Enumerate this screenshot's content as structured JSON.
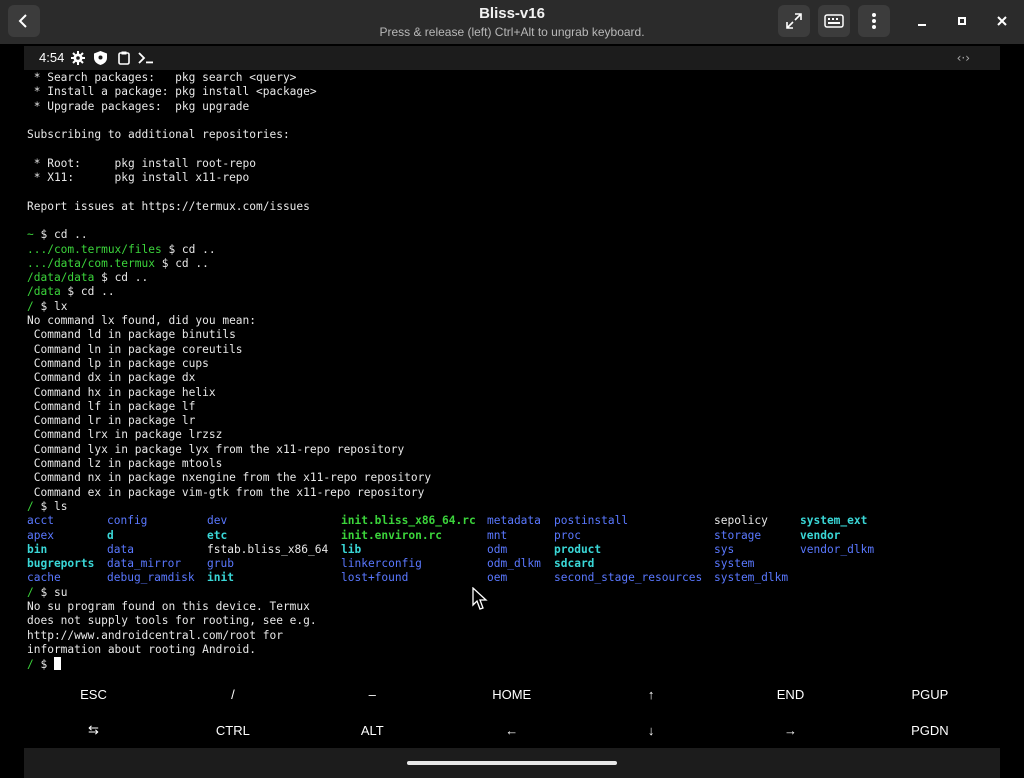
{
  "window": {
    "title": "Bliss-v16",
    "subtitle": "Press & release (left) Ctrl+Alt to ungrab keyboard."
  },
  "statusbar": {
    "time": "4:54"
  },
  "terminal": {
    "lines_top": [
      {
        "parts": [
          {
            "t": " * Search packages:   pkg search <query>"
          }
        ]
      },
      {
        "parts": [
          {
            "t": " * Install a package: pkg install <package>"
          }
        ]
      },
      {
        "parts": [
          {
            "t": " * Upgrade packages:  pkg upgrade"
          }
        ]
      },
      {
        "parts": [
          {
            "t": ""
          }
        ]
      },
      {
        "parts": [
          {
            "t": "Subscribing to additional repositories:"
          }
        ]
      },
      {
        "parts": [
          {
            "t": ""
          }
        ]
      },
      {
        "parts": [
          {
            "t": " * Root:     pkg install root-repo"
          }
        ]
      },
      {
        "parts": [
          {
            "t": " * X11:      pkg install x11-repo"
          }
        ]
      },
      {
        "parts": [
          {
            "t": ""
          }
        ]
      },
      {
        "parts": [
          {
            "t": "Report issues at https://termux.com/issues"
          }
        ]
      },
      {
        "parts": [
          {
            "t": ""
          }
        ]
      },
      {
        "parts": [
          {
            "t": "~",
            "c": "green"
          },
          {
            "t": " $ cd .."
          }
        ]
      },
      {
        "parts": [
          {
            "t": ".../com.termux/files",
            "c": "green"
          },
          {
            "t": " $ cd .."
          }
        ]
      },
      {
        "parts": [
          {
            "t": ".../data/com.termux",
            "c": "green"
          },
          {
            "t": " $ cd .."
          }
        ]
      },
      {
        "parts": [
          {
            "t": "/data/data",
            "c": "green"
          },
          {
            "t": " $ cd .."
          }
        ]
      },
      {
        "parts": [
          {
            "t": "/data",
            "c": "green"
          },
          {
            "t": " $ cd .."
          }
        ]
      },
      {
        "parts": [
          {
            "t": "/",
            "c": "green"
          },
          {
            "t": " $ lx"
          }
        ]
      },
      {
        "parts": [
          {
            "t": "No command lx found, did you mean:"
          }
        ]
      },
      {
        "parts": [
          {
            "t": " Command ld in package binutils"
          }
        ]
      },
      {
        "parts": [
          {
            "t": " Command ln in package coreutils"
          }
        ]
      },
      {
        "parts": [
          {
            "t": " Command lp in package cups"
          }
        ]
      },
      {
        "parts": [
          {
            "t": " Command dx in package dx"
          }
        ]
      },
      {
        "parts": [
          {
            "t": " Command hx in package helix"
          }
        ]
      },
      {
        "parts": [
          {
            "t": " Command lf in package lf"
          }
        ]
      },
      {
        "parts": [
          {
            "t": " Command lr in package lr"
          }
        ]
      },
      {
        "parts": [
          {
            "t": " Command lrx in package lrzsz"
          }
        ]
      },
      {
        "parts": [
          {
            "t": " Command lyx in package lyx from the x11-repo repository"
          }
        ]
      },
      {
        "parts": [
          {
            "t": " Command lz in package mtools"
          }
        ]
      },
      {
        "parts": [
          {
            "t": " Command nx in package nxengine from the x11-repo repository"
          }
        ]
      },
      {
        "parts": [
          {
            "t": " Command ex in package vim-gtk from the x11-repo repository"
          }
        ]
      },
      {
        "parts": [
          {
            "t": "/",
            "c": "green"
          },
          {
            "t": " $ ls"
          }
        ]
      }
    ],
    "ls_rows": [
      [
        {
          "t": "acct",
          "c": "blue"
        },
        {
          "t": "config",
          "c": "blue"
        },
        {
          "t": "dev",
          "c": "blue"
        },
        {
          "t": "init.bliss_x86_64.rc",
          "c": "green"
        },
        {
          "t": "metadata",
          "c": "blue"
        },
        {
          "t": "postinstall",
          "c": "blue"
        },
        {
          "t": "sepolicy",
          "c": ""
        },
        {
          "t": "system_ext",
          "c": "cyan"
        }
      ],
      [
        {
          "t": "apex",
          "c": "blue"
        },
        {
          "t": "d",
          "c": "cyan"
        },
        {
          "t": "etc",
          "c": "cyan"
        },
        {
          "t": "init.environ.rc",
          "c": "green"
        },
        {
          "t": "mnt",
          "c": "blue"
        },
        {
          "t": "proc",
          "c": "blue"
        },
        {
          "t": "storage",
          "c": "blue"
        },
        {
          "t": "vendor",
          "c": "cyan"
        }
      ],
      [
        {
          "t": "bin",
          "c": "cyan"
        },
        {
          "t": "data",
          "c": "blue"
        },
        {
          "t": "fstab.bliss_x86_64",
          "c": ""
        },
        {
          "t": "lib",
          "c": "cyan"
        },
        {
          "t": "odm",
          "c": "blue"
        },
        {
          "t": "product",
          "c": "cyan"
        },
        {
          "t": "sys",
          "c": "blue"
        },
        {
          "t": "vendor_dlkm",
          "c": "blue"
        }
      ],
      [
        {
          "t": "bugreports",
          "c": "cyan"
        },
        {
          "t": "data_mirror",
          "c": "blue"
        },
        {
          "t": "grub",
          "c": "blue"
        },
        {
          "t": "linkerconfig",
          "c": "blue"
        },
        {
          "t": "odm_dlkm",
          "c": "blue"
        },
        {
          "t": "sdcard",
          "c": "cyan"
        },
        {
          "t": "system",
          "c": "blue"
        },
        {
          "t": "",
          "c": ""
        }
      ],
      [
        {
          "t": "cache",
          "c": "blue"
        },
        {
          "t": "debug_ramdisk",
          "c": "blue"
        },
        {
          "t": "init",
          "c": "cyan"
        },
        {
          "t": "lost+found",
          "c": "blue"
        },
        {
          "t": "oem",
          "c": "blue"
        },
        {
          "t": "second_stage_resources",
          "c": "blue"
        },
        {
          "t": "system_dlkm",
          "c": "blue"
        },
        {
          "t": "",
          "c": ""
        }
      ]
    ],
    "lines_bottom": [
      {
        "parts": [
          {
            "t": "/",
            "c": "green"
          },
          {
            "t": " $ su"
          }
        ]
      },
      {
        "parts": [
          {
            "t": "No su program found on this device. Termux"
          }
        ]
      },
      {
        "parts": [
          {
            "t": "does not supply tools for rooting, see e.g."
          }
        ]
      },
      {
        "parts": [
          {
            "t": "http://www.androidcentral.com/root for"
          }
        ]
      },
      {
        "parts": [
          {
            "t": "information about rooting Android."
          }
        ]
      }
    ],
    "prompt_path": "/",
    "prompt_symbol": " $ "
  },
  "extra_keys": {
    "row1": [
      "ESC",
      "/",
      "–",
      "HOME",
      "↑",
      "END",
      "PGUP"
    ],
    "row2": [
      "⇆",
      "CTRL",
      "ALT",
      "←",
      "↓",
      "→",
      "PGDN"
    ]
  }
}
